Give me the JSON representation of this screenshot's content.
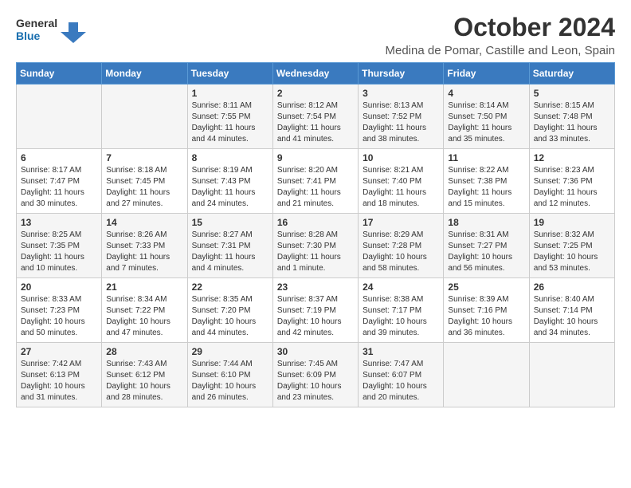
{
  "header": {
    "logo_line1": "General",
    "logo_line2": "Blue",
    "title": "October 2024",
    "subtitle": "Medina de Pomar, Castille and Leon, Spain"
  },
  "weekdays": [
    "Sunday",
    "Monday",
    "Tuesday",
    "Wednesday",
    "Thursday",
    "Friday",
    "Saturday"
  ],
  "weeks": [
    [
      {
        "day": "",
        "info": ""
      },
      {
        "day": "",
        "info": ""
      },
      {
        "day": "1",
        "info": "Sunrise: 8:11 AM\nSunset: 7:55 PM\nDaylight: 11 hours and 44 minutes."
      },
      {
        "day": "2",
        "info": "Sunrise: 8:12 AM\nSunset: 7:54 PM\nDaylight: 11 hours and 41 minutes."
      },
      {
        "day": "3",
        "info": "Sunrise: 8:13 AM\nSunset: 7:52 PM\nDaylight: 11 hours and 38 minutes."
      },
      {
        "day": "4",
        "info": "Sunrise: 8:14 AM\nSunset: 7:50 PM\nDaylight: 11 hours and 35 minutes."
      },
      {
        "day": "5",
        "info": "Sunrise: 8:15 AM\nSunset: 7:48 PM\nDaylight: 11 hours and 33 minutes."
      }
    ],
    [
      {
        "day": "6",
        "info": "Sunrise: 8:17 AM\nSunset: 7:47 PM\nDaylight: 11 hours and 30 minutes."
      },
      {
        "day": "7",
        "info": "Sunrise: 8:18 AM\nSunset: 7:45 PM\nDaylight: 11 hours and 27 minutes."
      },
      {
        "day": "8",
        "info": "Sunrise: 8:19 AM\nSunset: 7:43 PM\nDaylight: 11 hours and 24 minutes."
      },
      {
        "day": "9",
        "info": "Sunrise: 8:20 AM\nSunset: 7:41 PM\nDaylight: 11 hours and 21 minutes."
      },
      {
        "day": "10",
        "info": "Sunrise: 8:21 AM\nSunset: 7:40 PM\nDaylight: 11 hours and 18 minutes."
      },
      {
        "day": "11",
        "info": "Sunrise: 8:22 AM\nSunset: 7:38 PM\nDaylight: 11 hours and 15 minutes."
      },
      {
        "day": "12",
        "info": "Sunrise: 8:23 AM\nSunset: 7:36 PM\nDaylight: 11 hours and 12 minutes."
      }
    ],
    [
      {
        "day": "13",
        "info": "Sunrise: 8:25 AM\nSunset: 7:35 PM\nDaylight: 11 hours and 10 minutes."
      },
      {
        "day": "14",
        "info": "Sunrise: 8:26 AM\nSunset: 7:33 PM\nDaylight: 11 hours and 7 minutes."
      },
      {
        "day": "15",
        "info": "Sunrise: 8:27 AM\nSunset: 7:31 PM\nDaylight: 11 hours and 4 minutes."
      },
      {
        "day": "16",
        "info": "Sunrise: 8:28 AM\nSunset: 7:30 PM\nDaylight: 11 hours and 1 minute."
      },
      {
        "day": "17",
        "info": "Sunrise: 8:29 AM\nSunset: 7:28 PM\nDaylight: 10 hours and 58 minutes."
      },
      {
        "day": "18",
        "info": "Sunrise: 8:31 AM\nSunset: 7:27 PM\nDaylight: 10 hours and 56 minutes."
      },
      {
        "day": "19",
        "info": "Sunrise: 8:32 AM\nSunset: 7:25 PM\nDaylight: 10 hours and 53 minutes."
      }
    ],
    [
      {
        "day": "20",
        "info": "Sunrise: 8:33 AM\nSunset: 7:23 PM\nDaylight: 10 hours and 50 minutes."
      },
      {
        "day": "21",
        "info": "Sunrise: 8:34 AM\nSunset: 7:22 PM\nDaylight: 10 hours and 47 minutes."
      },
      {
        "day": "22",
        "info": "Sunrise: 8:35 AM\nSunset: 7:20 PM\nDaylight: 10 hours and 44 minutes."
      },
      {
        "day": "23",
        "info": "Sunrise: 8:37 AM\nSunset: 7:19 PM\nDaylight: 10 hours and 42 minutes."
      },
      {
        "day": "24",
        "info": "Sunrise: 8:38 AM\nSunset: 7:17 PM\nDaylight: 10 hours and 39 minutes."
      },
      {
        "day": "25",
        "info": "Sunrise: 8:39 AM\nSunset: 7:16 PM\nDaylight: 10 hours and 36 minutes."
      },
      {
        "day": "26",
        "info": "Sunrise: 8:40 AM\nSunset: 7:14 PM\nDaylight: 10 hours and 34 minutes."
      }
    ],
    [
      {
        "day": "27",
        "info": "Sunrise: 7:42 AM\nSunset: 6:13 PM\nDaylight: 10 hours and 31 minutes."
      },
      {
        "day": "28",
        "info": "Sunrise: 7:43 AM\nSunset: 6:12 PM\nDaylight: 10 hours and 28 minutes."
      },
      {
        "day": "29",
        "info": "Sunrise: 7:44 AM\nSunset: 6:10 PM\nDaylight: 10 hours and 26 minutes."
      },
      {
        "day": "30",
        "info": "Sunrise: 7:45 AM\nSunset: 6:09 PM\nDaylight: 10 hours and 23 minutes."
      },
      {
        "day": "31",
        "info": "Sunrise: 7:47 AM\nSunset: 6:07 PM\nDaylight: 10 hours and 20 minutes."
      },
      {
        "day": "",
        "info": ""
      },
      {
        "day": "",
        "info": ""
      }
    ]
  ]
}
